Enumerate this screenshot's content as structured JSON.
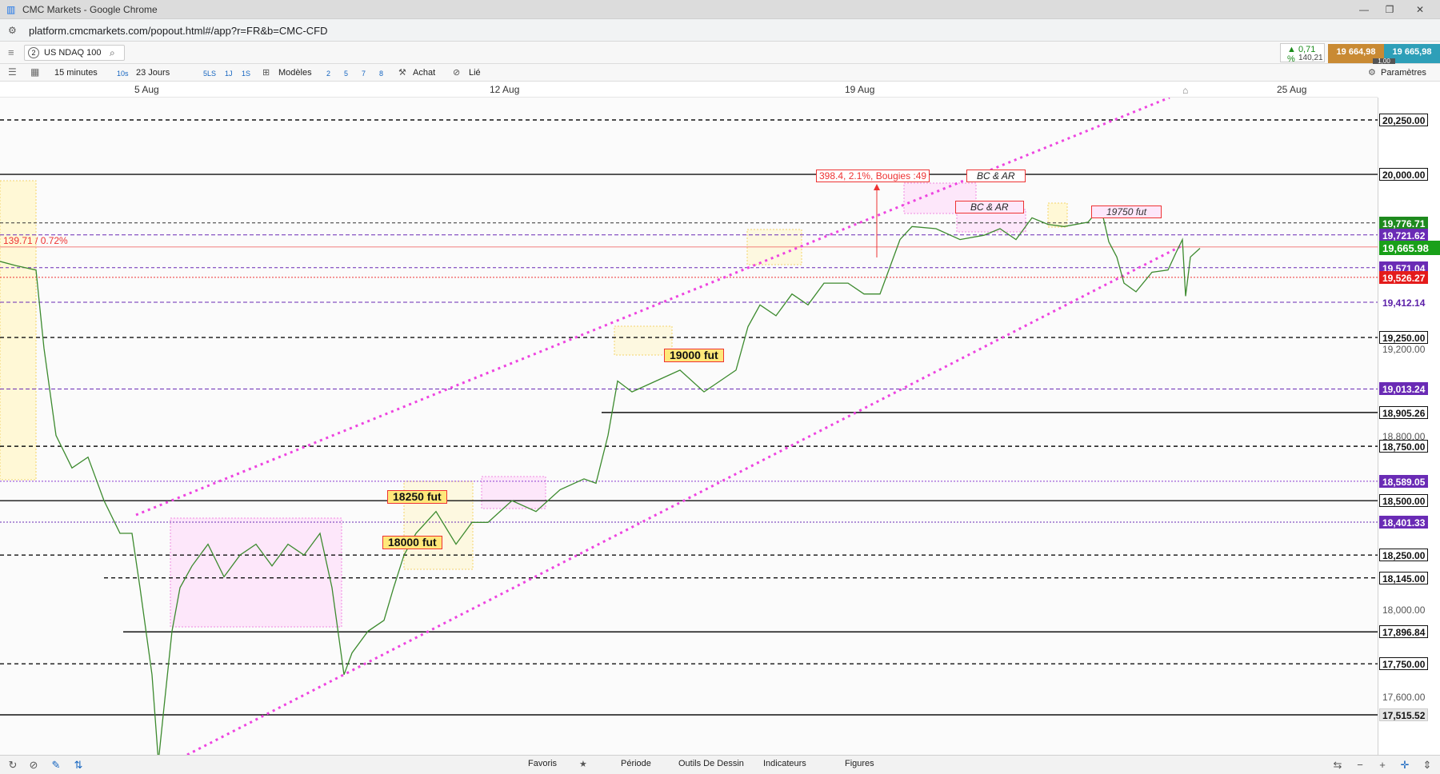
{
  "window": {
    "title": "CMC Markets - Google Chrome",
    "url": "platform.cmcmarkets.com/popout.html#/app?r=FR&b=CMC-CFD"
  },
  "instrument": {
    "badge": "2",
    "name": "US NDAQ 100"
  },
  "toolbar": {
    "interval": "15 minutes",
    "speed": "10s",
    "range": "23 Jours",
    "quick_ranges": [
      "5LS",
      "1J",
      "1S"
    ],
    "models": "Modèles",
    "layouts": [
      "2",
      "5",
      "7",
      "8"
    ],
    "buy": "Achat",
    "link": "Lié",
    "settings": "Paramètres"
  },
  "quote": {
    "change_pct": "▲ 0,71 %",
    "change_pts": "140,21",
    "sell": "19 664,98",
    "buy": "19 665,98",
    "spread": "1,00"
  },
  "dates": [
    "5 Aug",
    "12 Aug",
    "19 Aug",
    "25 Aug"
  ],
  "price_labels": [
    {
      "text": "20,250.00",
      "style": "plain"
    },
    {
      "text": "20,000.00",
      "style": "plain"
    },
    {
      "text": "19,776.71",
      "style": "green"
    },
    {
      "text": "19,721.62",
      "style": "green2"
    },
    {
      "text": "19,665.98",
      "style": "greenbig"
    },
    {
      "text": "19,571.04",
      "style": "purple"
    },
    {
      "text": "19,526.27",
      "style": "red"
    },
    {
      "text": "19,412.14",
      "style": "purplet"
    },
    {
      "text": "19,250.00",
      "style": "plain"
    },
    {
      "text": "19,200.00",
      "style": "axis"
    },
    {
      "text": "19,013.24",
      "style": "purple"
    },
    {
      "text": "18,905.26",
      "style": "plain"
    },
    {
      "text": "18,800.00",
      "style": "axis"
    },
    {
      "text": "18,750.00",
      "style": "plain"
    },
    {
      "text": "18,589.05",
      "style": "purple"
    },
    {
      "text": "18,500.00",
      "style": "plain"
    },
    {
      "text": "18,401.33",
      "style": "purple"
    },
    {
      "text": "18,250.00",
      "style": "plain"
    },
    {
      "text": "18,145.00",
      "style": "plain"
    },
    {
      "text": "18,000.00",
      "style": "axis"
    },
    {
      "text": "17,896.84",
      "style": "plain"
    },
    {
      "text": "17,750.00",
      "style": "plain"
    },
    {
      "text": "17,600.00",
      "style": "axis"
    },
    {
      "text": "17,515.52",
      "style": "grey"
    }
  ],
  "annotations": {
    "measure": "398.4, 2.1%, Bougies :49",
    "bc_ar_1": "BC & AR",
    "bc_ar_2": "BC & AR",
    "fut_19750": "19750  fut",
    "fut_19000": "19000 fut",
    "fut_18250": "18250 fut",
    "fut_18000": "18000 fut",
    "left_pct": "139.71 / 0.72%"
  },
  "bottom": {
    "favoris": "Favoris",
    "periode": "Période",
    "outils": "Outils De Dessin",
    "indicateurs": "Indicateurs",
    "figures": "Figures"
  }
}
